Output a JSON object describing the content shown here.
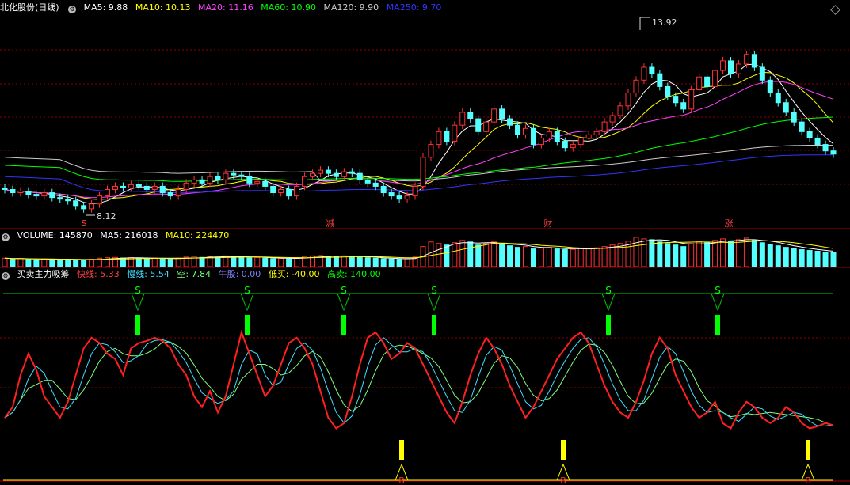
{
  "colors": {
    "up": "#ff3333",
    "down": "#54ffff",
    "ma5": "#ffffff",
    "ma10": "#ffff00",
    "ma20": "#ff40ff",
    "ma60": "#00ff00",
    "ma120": "#cccccc",
    "ma250": "#3333ff",
    "fast": "#ff2020",
    "slow": "#40e0ff",
    "empty": "#80ff80",
    "grid": "#8b0000"
  },
  "main": {
    "title": "北化股份(日线)",
    "ma5": "MA5: 9.88",
    "ma10": "MA10: 10.13",
    "ma20": "MA20: 11.16",
    "ma60": "MA60: 10.90",
    "ma120": "MA120: 9.90",
    "ma250": "MA250: 9.70",
    "high_label": "13.92",
    "low_label": "8.12",
    "markers": [
      "S",
      "减",
      "财",
      "涨"
    ]
  },
  "volume": {
    "title": "VOLUME: 145870",
    "ma5": "MA5: 216018",
    "ma10": "MA10: 224470"
  },
  "indicator": {
    "title": "买卖主力吸筹",
    "fast": "快线: 5.33",
    "slow": "慢线: 5.54",
    "empty": "空: 7.84",
    "bull": "牛股: 0.00",
    "low_buy": "低买: -40.00",
    "high_sell": "高卖: 140.00",
    "sell_signal": "S",
    "buy_signal": "B"
  },
  "chart_data": {
    "type": "candlestick",
    "price_range": [
      8.12,
      13.92
    ],
    "closes": [
      8.8,
      8.7,
      8.75,
      8.65,
      8.6,
      8.7,
      8.55,
      8.5,
      8.45,
      8.3,
      8.2,
      8.35,
      8.6,
      8.8,
      8.9,
      8.85,
      8.95,
      8.9,
      8.8,
      8.9,
      8.7,
      8.6,
      8.8,
      9.0,
      9.1,
      9.0,
      9.2,
      9.1,
      9.3,
      9.25,
      9.2,
      9.0,
      9.05,
      8.9,
      8.7,
      8.8,
      8.6,
      8.9,
      9.2,
      9.3,
      9.4,
      9.3,
      9.2,
      9.35,
      9.3,
      9.1,
      9.0,
      8.9,
      8.7,
      8.6,
      8.5,
      8.6,
      8.9,
      9.8,
      10.2,
      10.6,
      10.3,
      10.8,
      11.2,
      11.0,
      10.6,
      10.9,
      11.3,
      11.0,
      10.8,
      10.5,
      10.7,
      10.2,
      10.4,
      10.6,
      10.3,
      10.1,
      10.2,
      10.4,
      10.5,
      10.6,
      10.9,
      11.1,
      11.4,
      11.8,
      12.2,
      12.6,
      12.4,
      12.0,
      11.7,
      11.5,
      11.3,
      11.9,
      12.3,
      12.0,
      12.5,
      12.8,
      12.4,
      12.7,
      13.0,
      12.6,
      12.2,
      11.8,
      11.5,
      11.2,
      10.9,
      10.6,
      10.4,
      10.2,
      10.0,
      9.9
    ],
    "volume": [
      55,
      50,
      52,
      48,
      45,
      50,
      47,
      44,
      46,
      43,
      42,
      48,
      55,
      58,
      60,
      56,
      58,
      55,
      52,
      56,
      50,
      48,
      55,
      62,
      66,
      60,
      65,
      62,
      70,
      66,
      62,
      58,
      60,
      55,
      52,
      54,
      50,
      58,
      66,
      70,
      72,
      68,
      65,
      70,
      66,
      60,
      58,
      55,
      52,
      50,
      48,
      52,
      62,
      130,
      160,
      150,
      140,
      155,
      170,
      160,
      140,
      150,
      160,
      145,
      135,
      125,
      130,
      115,
      120,
      125,
      115,
      110,
      112,
      118,
      120,
      122,
      130,
      140,
      150,
      165,
      190,
      180,
      175,
      160,
      150,
      140,
      130,
      150,
      165,
      155,
      170,
      180,
      165,
      175,
      185,
      170,
      155,
      145,
      135,
      125,
      118,
      110,
      105,
      100,
      95,
      90
    ],
    "fast_line": [
      20,
      30,
      60,
      80,
      65,
      40,
      30,
      20,
      35,
      60,
      85,
      95,
      90,
      80,
      75,
      60,
      85,
      90,
      92,
      95,
      92,
      85,
      70,
      60,
      40,
      30,
      45,
      25,
      40,
      70,
      100,
      80,
      60,
      40,
      50,
      70,
      90,
      95,
      85,
      70,
      45,
      20,
      10,
      15,
      40,
      70,
      95,
      100,
      90,
      75,
      80,
      90,
      85,
      70,
      55,
      40,
      25,
      15,
      35,
      60,
      80,
      95,
      85,
      70,
      50,
      35,
      20,
      30,
      45,
      60,
      75,
      85,
      95,
      100,
      90,
      70,
      50,
      35,
      25,
      20,
      35,
      55,
      80,
      95,
      85,
      60,
      45,
      30,
      20,
      25,
      35,
      15,
      10,
      25,
      35,
      30,
      20,
      15,
      20,
      30,
      25,
      15,
      10,
      12,
      15,
      13
    ]
  }
}
